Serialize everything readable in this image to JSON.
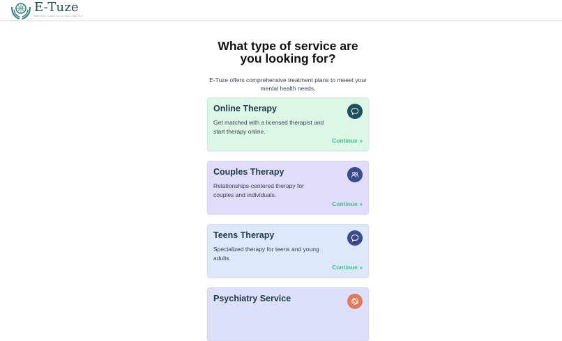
{
  "header": {
    "logo_name": "E-Tuze",
    "logo_tagline": "MENTAL HEALTH & WELLBEING"
  },
  "main": {
    "title": "What type of service are you looking for?",
    "subtitle": "E-Tuze offers comprehensive treatment plans to meeet your mental health needs."
  },
  "services": [
    {
      "title": "Online Therapy",
      "description": "Get matched with a licensed therapist and start therapy online.",
      "link": "Continue »",
      "icon": "chat-bubble-icon",
      "bg": "#dcf7e6",
      "icon_bg": "#1f4e5c"
    },
    {
      "title": "Couples Therapy",
      "description": "Relationships-centered therapy for couples and individuals.",
      "link": "Continue »",
      "icon": "users-icon",
      "bg": "#e2dcfb",
      "icon_bg": "#3b4a8c"
    },
    {
      "title": "Teens Therapy",
      "description": "Specialized therapy for teens and young adults.",
      "link": "Continue »",
      "icon": "chat-bubble-icon",
      "bg": "#dde8fb",
      "icon_bg": "#3b4a8c"
    },
    {
      "title": "Psychiatry Service",
      "description": "",
      "link": "",
      "icon": "pill-icon",
      "bg": "#dce0fb",
      "icon_bg": "#e07a5f"
    }
  ],
  "colors": {
    "accent": "#3fbf8e",
    "title": "#1f3b4d"
  }
}
